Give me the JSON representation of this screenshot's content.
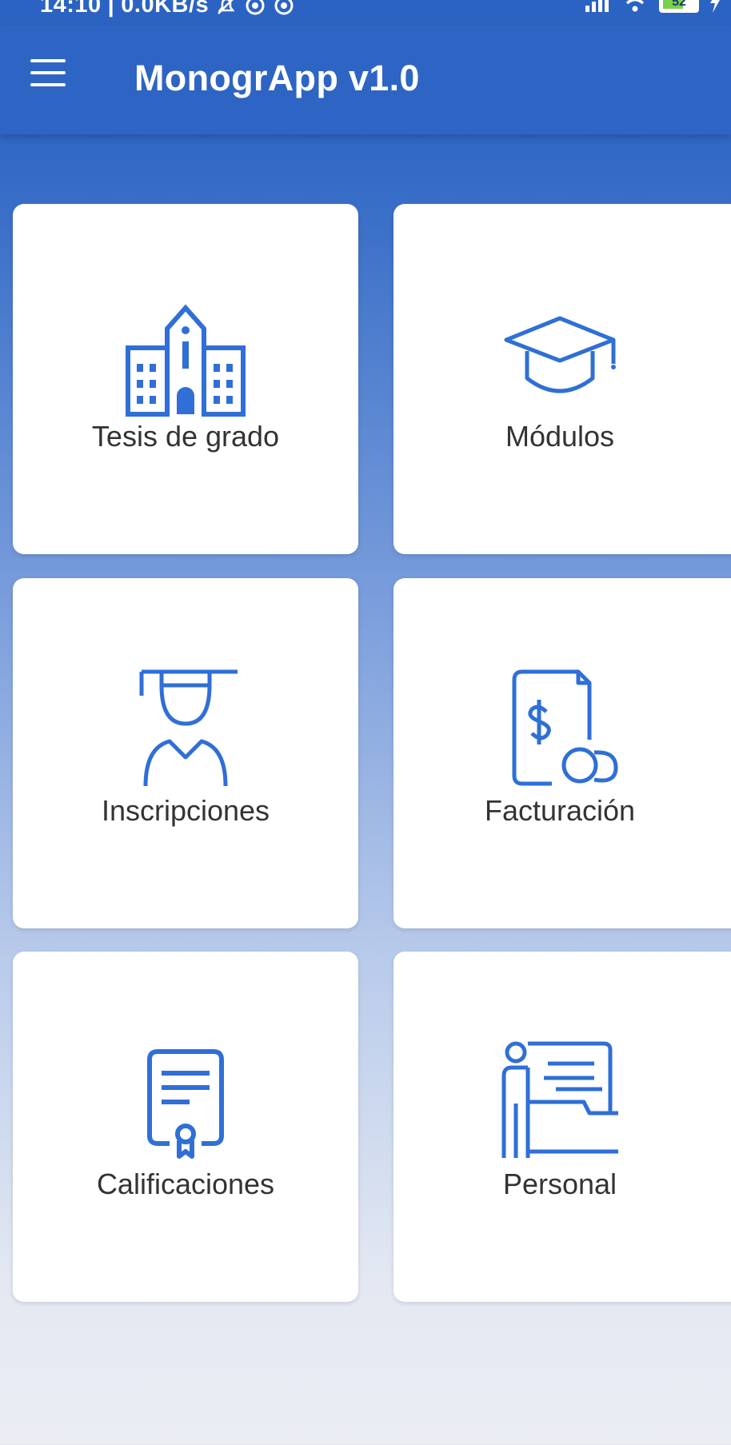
{
  "status_bar": {
    "time": "14:10",
    "speed": "0.0KB/s",
    "battery": "52",
    "icons": [
      "mute-icon",
      "sync-icon",
      "sync-icon",
      "signal-icon",
      "wifi-icon",
      "battery-icon",
      "charging-icon"
    ]
  },
  "app_bar": {
    "title": "MonogrApp v1.0",
    "menu_icon": "hamburger-menu-icon"
  },
  "tiles": [
    {
      "label": "Tesis de grado",
      "icon": "university-building-icon"
    },
    {
      "label": "Módulos",
      "icon": "graduation-cap-icon"
    },
    {
      "label": "Inscripciones",
      "icon": "student-icon"
    },
    {
      "label": "Facturación",
      "icon": "invoice-coins-icon"
    },
    {
      "label": "Calificaciones",
      "icon": "certificate-icon"
    },
    {
      "label": "Personal",
      "icon": "teacher-board-icon"
    }
  ],
  "colors": {
    "app_bar": "#2e65c4",
    "icon_blue": "#2f6fd6",
    "card": "#ffffff",
    "label_text": "#333333"
  }
}
